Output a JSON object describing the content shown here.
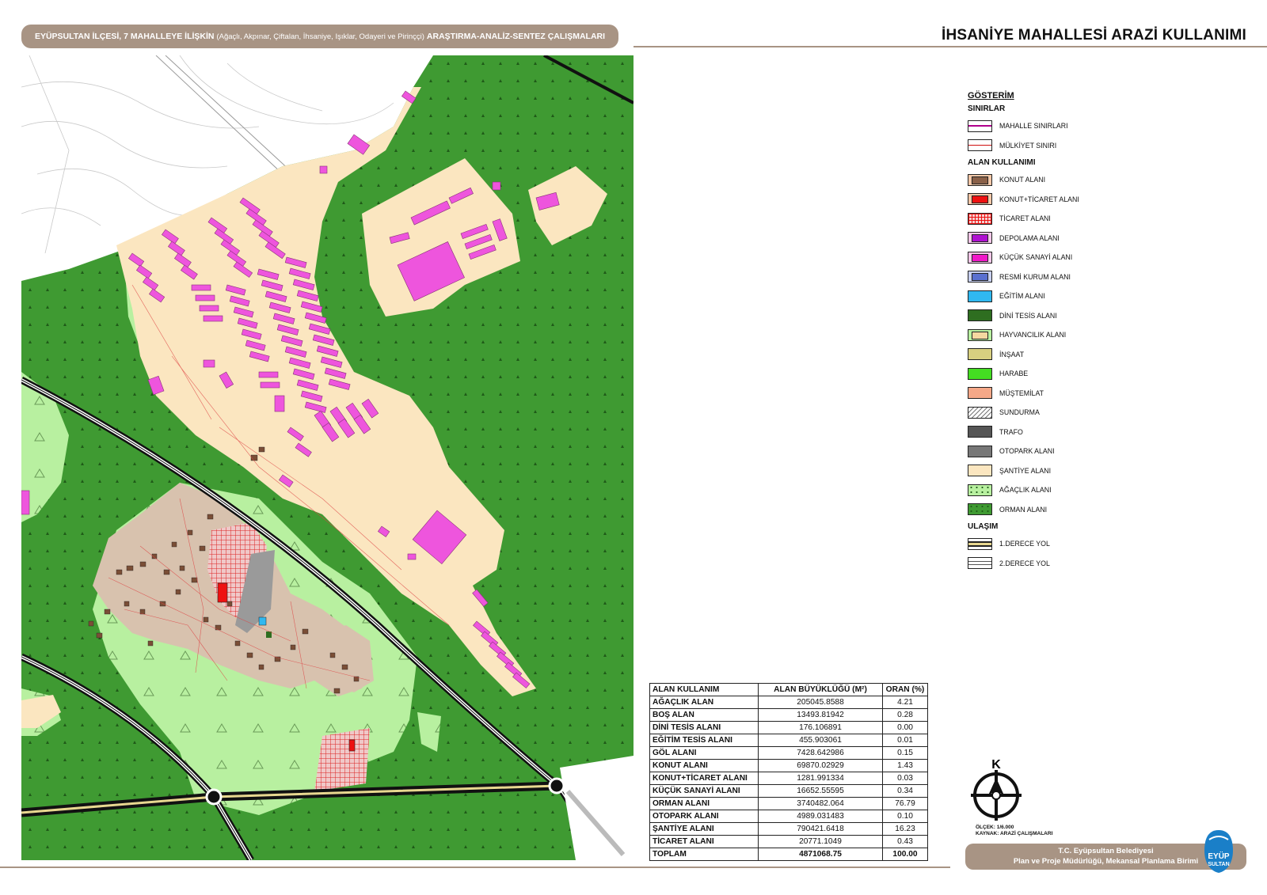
{
  "header": {
    "banner_main": "EYÜPSULTAN İLÇESİ, 7 MAHALLEYE İLİŞKİN",
    "banner_sub": "(Ağaçlı, Akpınar, Çiftalan, İhsaniye, Işıklar, Odayeri ve Pirinççi)",
    "banner_end": "ARAŞTIRMA-ANALİZ-SENTEZ ÇALIŞMALARI",
    "title": "İHSANİYE MAHALLESİ ARAZİ KULLANIMI"
  },
  "legend": {
    "title": "GÖSTERİM",
    "sections": [
      {
        "name": "SINIRLAR",
        "items": [
          {
            "label": "MAHALLE SINIRLARI",
            "fill": "#ffffff",
            "line": "#b0008c",
            "style": "line"
          },
          {
            "label": "MÜLKİYET SINIRI",
            "fill": "#ffffff",
            "line": "#d01010",
            "style": "line"
          }
        ]
      },
      {
        "name": "ALAN KULLANIMI",
        "items": [
          {
            "label": "KONUT ALANI",
            "fill": "#f3c8a8",
            "inner": "#8a6048",
            "style": "inner"
          },
          {
            "label": "KONUT+TİCARET ALANI",
            "fill": "#f3c8a8",
            "inner": "#ee1111",
            "style": "inner"
          },
          {
            "label": "TİCARET ALANI",
            "fill": "#ee1111",
            "style": "hatch"
          },
          {
            "label": "DEPOLAMA ALANI",
            "fill": "#f3c8e8",
            "inner": "#b010d0",
            "style": "inner"
          },
          {
            "label": "KÜÇÜK SANAYİ ALANI",
            "fill": "#f3c8e8",
            "inner": "#f018c8",
            "style": "inner"
          },
          {
            "label": "RESMİ KURUM ALANI",
            "fill": "#c8d0f0",
            "inner": "#5a70d0",
            "style": "inner"
          },
          {
            "label": "EĞİTİM ALANI",
            "fill": "#30b8f0",
            "style": "solid"
          },
          {
            "label": "DİNİ TESİS ALANI",
            "fill": "#2e6e20",
            "style": "solid"
          },
          {
            "label": "HAYVANCILIK ALANI",
            "fill": "#b8f0a0",
            "inner": "#f5d8a0",
            "style": "inner"
          },
          {
            "label": "İNŞAAT",
            "fill": "#d8d080",
            "style": "solid"
          },
          {
            "label": "HARABE",
            "fill": "#44dd22",
            "style": "solid"
          },
          {
            "label": "MÜŞTEMİLAT",
            "fill": "#f5a888",
            "style": "solid"
          },
          {
            "label": "SUNDURMA",
            "fill": "#ffffff",
            "style": "diag"
          },
          {
            "label": "TRAFO",
            "fill": "#555555",
            "style": "solid"
          },
          {
            "label": "OTOPARK ALANI",
            "fill": "#777777",
            "style": "solid"
          },
          {
            "label": "ŞANTİYE ALANI",
            "fill": "#fbe6c0",
            "style": "solid"
          },
          {
            "label": "AĞAÇLIK ALANI",
            "fill": "#b8f0a0",
            "style": "dots"
          },
          {
            "label": "ORMAN ALANI",
            "fill": "#3f9a32",
            "style": "dots"
          }
        ]
      },
      {
        "name": "ULAŞIM",
        "items": [
          {
            "label": "1.DERECE YOL",
            "fill": "#ffffff",
            "line": "#222222",
            "style": "road1"
          },
          {
            "label": "2.DERECE YOL",
            "fill": "#ffffff",
            "line": "#444444",
            "style": "road2"
          }
        ]
      }
    ]
  },
  "stats_table": {
    "headers": [
      "ALAN KULLANIM",
      "ALAN BÜYÜKLÜĞÜ (M²)",
      "ORAN (%)"
    ],
    "rows": [
      [
        "AĞAÇLIK ALAN",
        "205045.8588",
        "4.21"
      ],
      [
        "BOŞ ALAN",
        "13493.81942",
        "0.28"
      ],
      [
        "DİNİ TESİS ALANI",
        "176.106891",
        "0.00"
      ],
      [
        "EĞİTİM TESİS ALANI",
        "455.903061",
        "0.01"
      ],
      [
        "GÖL ALANI",
        "7428.642986",
        "0.15"
      ],
      [
        "KONUT ALANI",
        "69870.02929",
        "1.43"
      ],
      [
        "KONUT+TİCARET ALANI",
        "1281.991334",
        "0.03"
      ],
      [
        "KÜÇÜK SANAYİ ALANI",
        "16652.55595",
        "0.34"
      ],
      [
        "ORMAN ALANI",
        "3740482.064",
        "76.79"
      ],
      [
        "OTOPARK ALANI",
        "4989.031483",
        "0.10"
      ],
      [
        "ŞANTİYE ALANI",
        "790421.6418",
        "16.23"
      ],
      [
        "TİCARET ALANI",
        "20771.1049",
        "0.43"
      ]
    ],
    "total": [
      "TOPLAM",
      "4871068.75",
      "100.00"
    ]
  },
  "compass": {
    "letter": "K"
  },
  "notes": {
    "scale": "ÖLÇEK: 1/6.000",
    "source": "KAYNAK: ARAZİ ÇALIŞMALARI"
  },
  "footer": {
    "line1": "T.C. Eyüpsultan Belediyesi",
    "line2": "Plan ve Proje Müdürlüğü, Mekansal Planlama Birimi"
  },
  "logo": {
    "text_top": "EYÜP",
    "text_bottom": "SULTAN"
  },
  "colors": {
    "forest": "#3f9a32",
    "woodland": "#b8f0a0",
    "site": "#fbe6c0",
    "residential": "#d8c2ae",
    "industry": "#ee55dd",
    "commerce": "#ee1111",
    "frame": "#a89484"
  }
}
